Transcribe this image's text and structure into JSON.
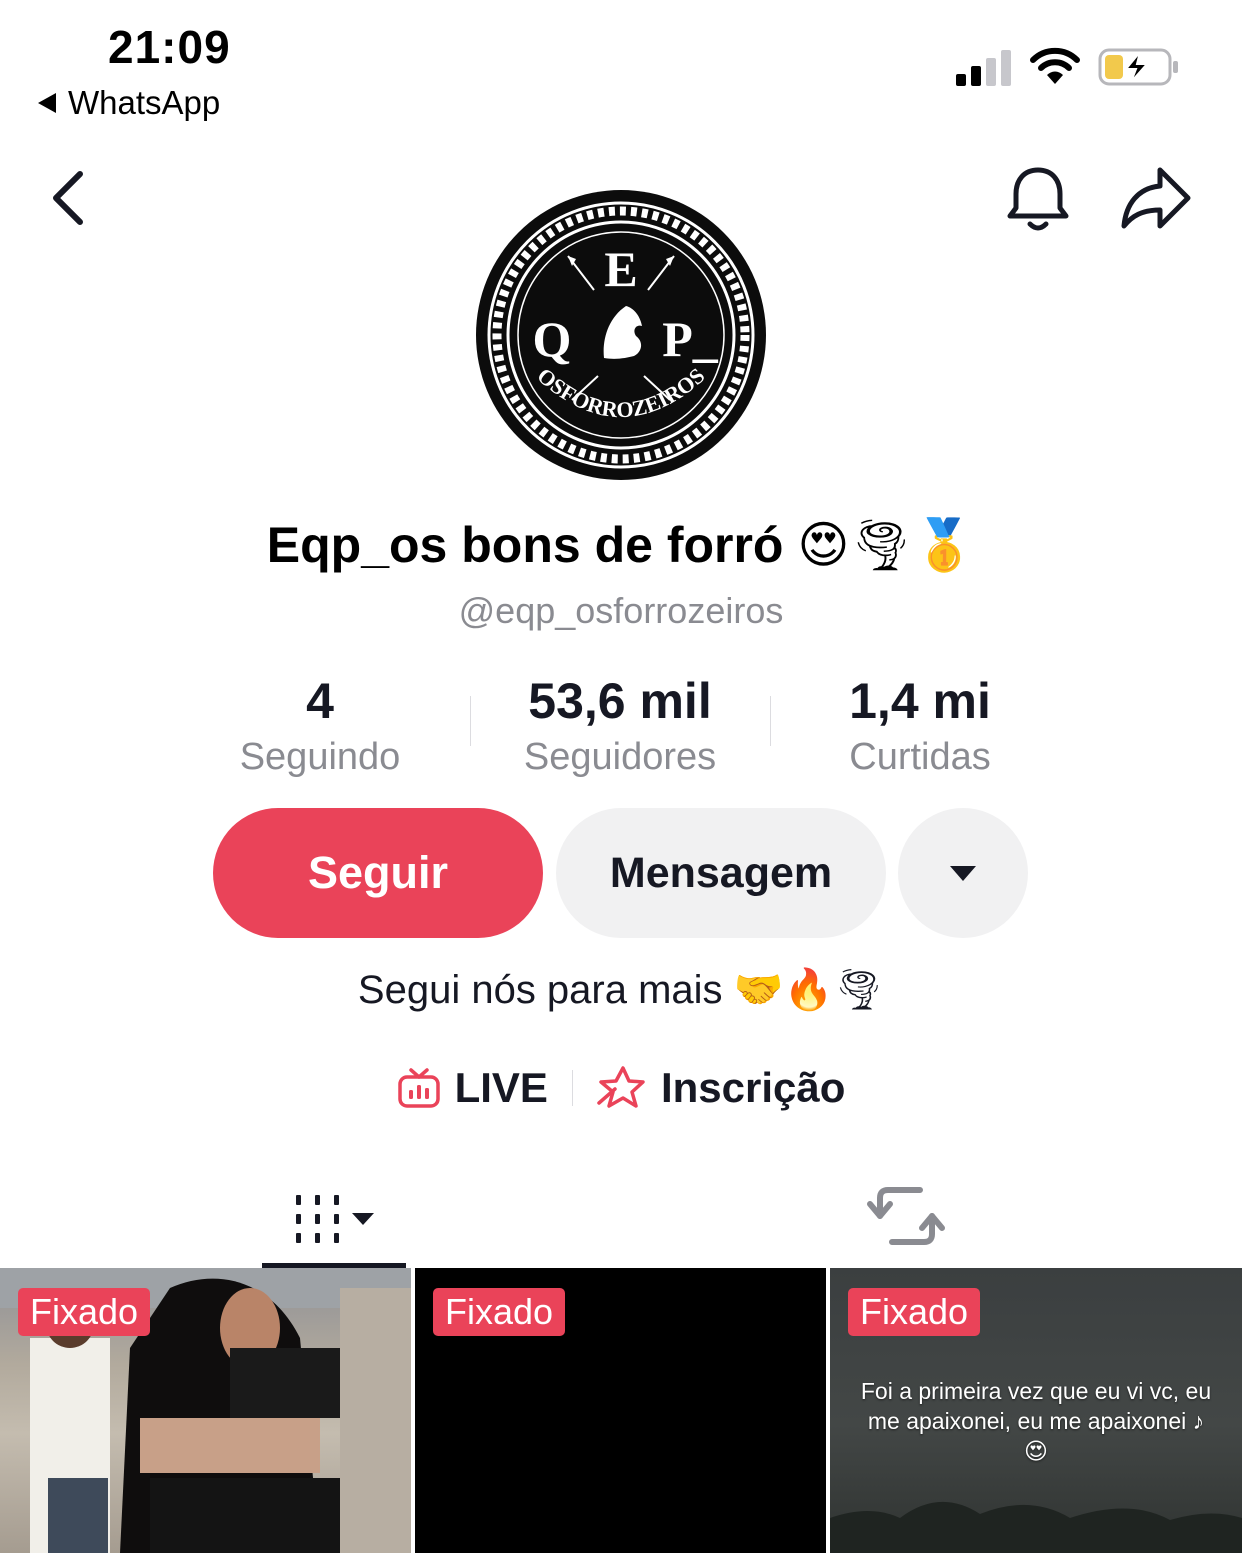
{
  "status_bar": {
    "time": "21:09",
    "back_app": "WhatsApp",
    "battery_color": "#f2c94c"
  },
  "profile": {
    "avatar_logo": {
      "top_letter": "E",
      "left_letter": "Q",
      "right_letter": "P_",
      "arc_text": "OSFORROZEIROS"
    },
    "display_name": "Eqp_os bons de forró",
    "display_name_emoji": "😍🌪🥇",
    "username": "@eqp_osforrozeiros",
    "stats": [
      {
        "value": "4",
        "label": "Seguindo"
      },
      {
        "value": "53,6 mil",
        "label": "Seguidores"
      },
      {
        "value": "1,4 mi",
        "label": "Curtidas"
      }
    ],
    "buttons": {
      "follow": "Seguir",
      "message": "Mensagem"
    },
    "bio": "Segui nós para mais",
    "bio_emoji": "🤝🔥🌪",
    "links": {
      "live": "LIVE",
      "subscription": "Inscrição"
    }
  },
  "tabs": {
    "videos_icon": "grid-columns-icon",
    "repost_icon": "repost-icon"
  },
  "videos": [
    {
      "badge": "Fixado",
      "overlay": ""
    },
    {
      "badge": "Fixado",
      "overlay": ""
    },
    {
      "badge": "Fixado",
      "overlay": "Foi a primeira vez que eu vi vc, eu me apaixonei, eu me apaixonei ♪ 😍"
    }
  ],
  "colors": {
    "accent": "#ea4359",
    "secondary_button": "#f1f1f2",
    "muted_text": "#8a8b91"
  }
}
